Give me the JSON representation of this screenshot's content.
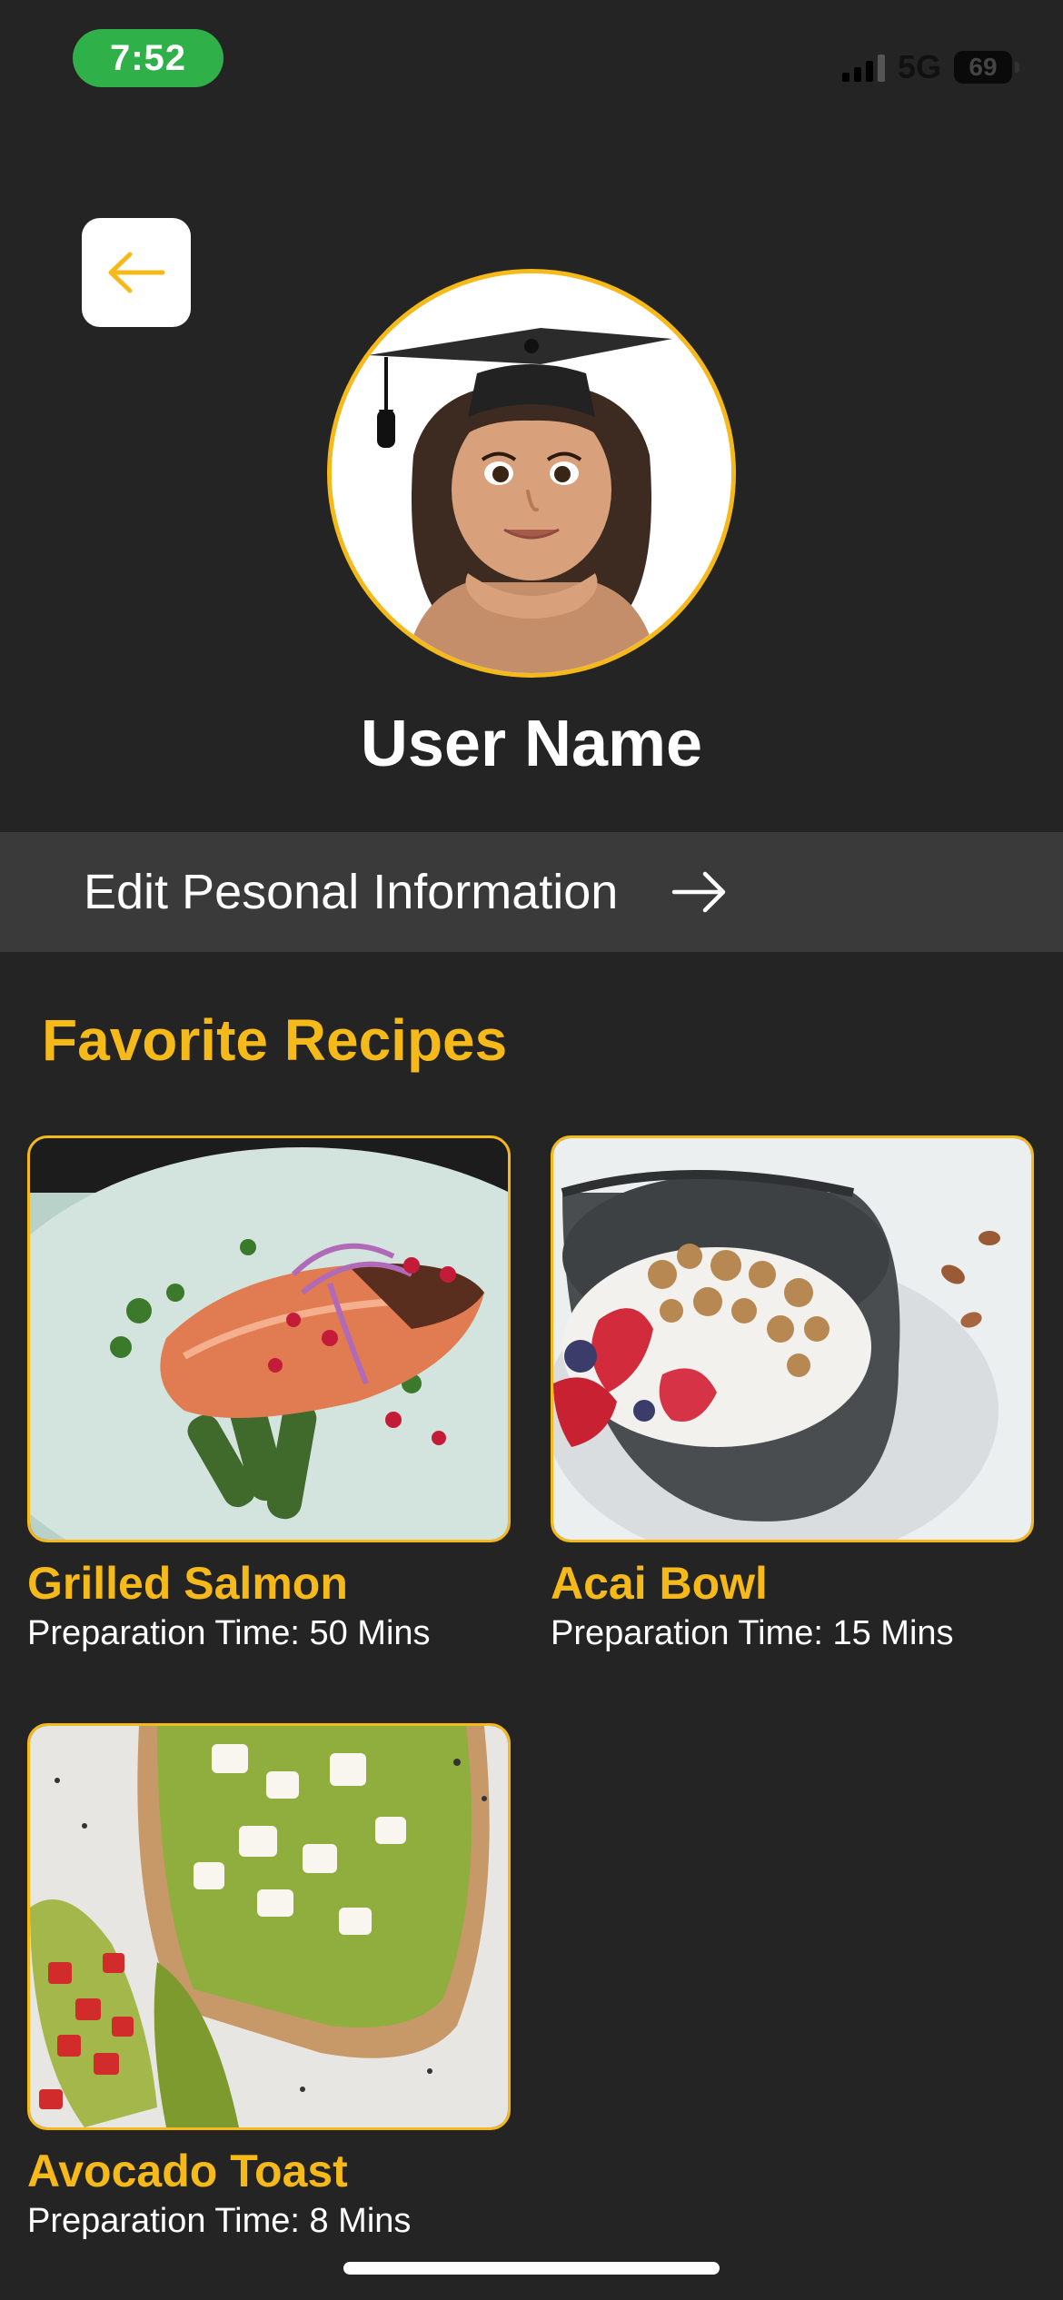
{
  "status": {
    "time": "7:52",
    "network": "5G",
    "battery": "69"
  },
  "header": {
    "back_icon": "arrow-left-icon",
    "avatar_icon": "memoji-avatar"
  },
  "profile": {
    "user_name": "User Name"
  },
  "edit": {
    "label": "Edit Pesonal Information",
    "icon": "arrow-right-icon"
  },
  "favorites": {
    "title": "Favorite Recipes",
    "recipes": [
      {
        "name": "Grilled Salmon",
        "prep": "Preparation Time: 50 Mins"
      },
      {
        "name": "Acai Bowl",
        "prep": "Preparation Time: 15 Mins"
      },
      {
        "name": "Avocado Toast",
        "prep": "Preparation Time: 8 Mins"
      }
    ]
  },
  "colors": {
    "accent": "#f6b91a",
    "background": "#242424",
    "bar": "#3a3a3a",
    "status_pill": "#2fb048"
  }
}
